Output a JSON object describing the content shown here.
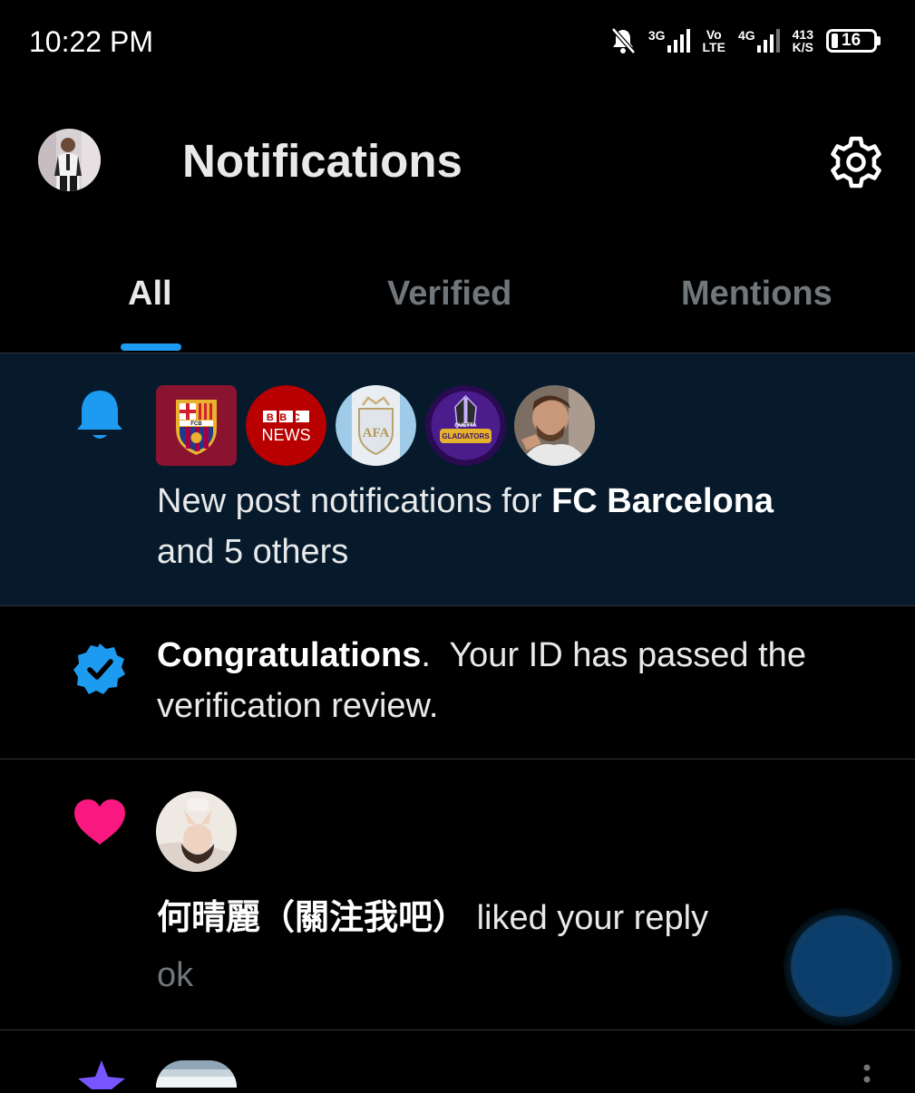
{
  "status_bar": {
    "time": "10:22 PM",
    "net_3g": "3G",
    "volte_top": "Vo",
    "volte_bottom": "LTE",
    "net_4g": "4G",
    "speed_value": "413",
    "speed_unit": "K/S",
    "battery": "16"
  },
  "header": {
    "title": "Notifications",
    "settings_icon": "gear-icon"
  },
  "tabs": [
    {
      "label": "All",
      "active": true
    },
    {
      "label": "Verified",
      "active": false
    },
    {
      "label": "Mentions",
      "active": false
    }
  ],
  "notifications": [
    {
      "icon": "bell-icon",
      "icon_color": "#1d9bf0",
      "text_before": "New post notifications for ",
      "text_bold": "FC Barcelona",
      "text_after": "and 5 others",
      "avatars": [
        {
          "label": "FCB"
        },
        {
          "top": "BBC",
          "bottom": "NEWS"
        },
        {
          "label": "AFA"
        },
        {
          "top": "QUETTA",
          "bottom": "GLADIATORS"
        },
        {
          "label": "person"
        }
      ]
    },
    {
      "icon": "verified-badge-icon",
      "icon_color": "#1d9bf0",
      "text_bold": "Congratulations",
      "text_after": ".  Your ID has passed the",
      "text_line2": "verification review."
    },
    {
      "icon": "heart-icon",
      "icon_color": "#f91880",
      "user_name": "何晴麗（關注我吧）",
      "text_after": " liked your reply",
      "reply_text": "ok"
    }
  ],
  "colors": {
    "accent": "#1d9bf0",
    "like": "#f91880",
    "highlight_bg": "#061a2c"
  }
}
